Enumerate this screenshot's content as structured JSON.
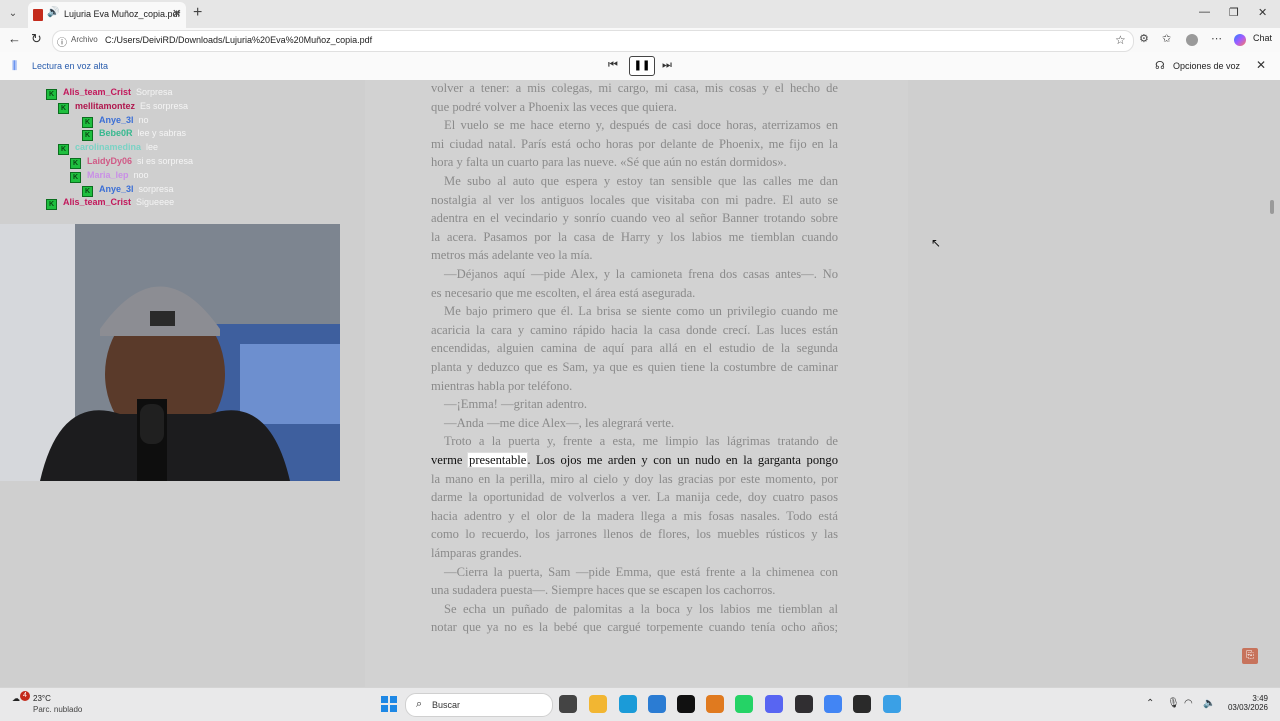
{
  "browser": {
    "tab_title": "Lujuria Eva Muñoz_copia.pdf",
    "address_prefix": "Archivo",
    "url": "C:/Users/DeiviRD/Downloads/Lujuria%20Eva%20Muñoz_copia.pdf",
    "chat_label": "Chat",
    "icons": [
      "tab-dropdown-icon",
      "pdf-icon",
      "speaker-icon",
      "close-icon",
      "plus-icon",
      "minimize-icon",
      "maximize-icon",
      "window-close-icon",
      "back-icon",
      "refresh-icon",
      "info-icon",
      "star-icon",
      "extensions-icon",
      "favorites-icon",
      "profile-icon",
      "more-icon",
      "copilot-icon"
    ]
  },
  "read_aloud": {
    "label": "Lectura en voz alta",
    "voice_options": "Opciones de voz"
  },
  "chat_overlay": [
    {
      "name": "Alis_team_Crist",
      "msg": "Sorpresa",
      "indent": 0,
      "color": "#c2185b"
    },
    {
      "name": "mellitamontez",
      "msg": "Es sorpresa",
      "indent": 1,
      "color": "#b0174e"
    },
    {
      "name": "Anye_3l",
      "msg": "no",
      "indent": 3,
      "color": "#3b6fd6"
    },
    {
      "name": "Bebe0R",
      "msg": "lee y sabras",
      "indent": 3,
      "color": "#37b98f"
    },
    {
      "name": "carolinamedina",
      "msg": "lee",
      "indent": 1,
      "color": "#7ad3c5"
    },
    {
      "name": "LaidyDy06",
      "msg": "si es sorpresa",
      "indent": 2,
      "color": "#d05a86"
    },
    {
      "name": "Maria_lep",
      "msg": "noo",
      "indent": 2,
      "color": "#c98fe6"
    },
    {
      "name": "Anye_3l",
      "msg": "sorpresa",
      "indent": 3,
      "color": "#3b6fd6"
    },
    {
      "name": "Alis_team_Crist",
      "msg": "Sigueeee",
      "indent": 0,
      "color": "#c2185b"
    }
  ],
  "pdf_lines": [
    {
      "text": "volver a tener: a mis colegas, mi cargo, mi casa, mis cosas y el hecho de",
      "j": true,
      "ind": false
    },
    {
      "text": "que podré volver a Phoenix las veces que quiera.",
      "j": false,
      "ind": false
    },
    {
      "text": "El vuelo se me hace eterno y, después de casi doce horas, aterrizamos en",
      "j": true,
      "ind": true
    },
    {
      "text": "mi ciudad natal. París está ocho horas por delante de Phoenix, me fijo en la",
      "j": true,
      "ind": false
    },
    {
      "text": "hora y falta un cuarto para las nueve. «Sé que aún no están dormidos».",
      "j": false,
      "ind": false
    },
    {
      "text": "Me subo al auto que espera y estoy tan sensible que las calles me dan",
      "j": true,
      "ind": true
    },
    {
      "text": "nostalgia al ver los antiguos locales que visitaba con mi padre. El auto se",
      "j": true,
      "ind": false
    },
    {
      "text": "adentra en el vecindario y sonrío cuando veo al señor Banner trotando sobre",
      "j": true,
      "ind": false
    },
    {
      "text": "la acera. Pasamos por la casa de Harry y los labios me tiemblan cuando",
      "j": true,
      "ind": false
    },
    {
      "text": "metros más adelante veo la mía.",
      "j": false,
      "ind": false
    },
    {
      "text": "—Déjanos aquí —pide Alex, y la camioneta frena dos casas antes—. No",
      "j": true,
      "ind": true
    },
    {
      "text": "es necesario que me escolten, el área está asegurada.",
      "j": false,
      "ind": false
    },
    {
      "text": "Me bajo primero que él. La brisa se siente como un privilegio cuando me",
      "j": true,
      "ind": true
    },
    {
      "text": "acaricia la cara y camino rápido hacia la casa donde crecí. Las luces están",
      "j": true,
      "ind": false
    },
    {
      "text": "encendidas, alguien camina de aquí para allá en el estudio de la segunda",
      "j": true,
      "ind": false
    },
    {
      "text": "planta y deduzco que es Sam, ya que es quien tiene la costumbre de caminar",
      "j": true,
      "ind": false
    },
    {
      "text": "mientras habla por teléfono.",
      "j": false,
      "ind": false
    },
    {
      "text": "—¡Emma! —gritan adentro.",
      "j": false,
      "ind": true
    },
    {
      "text": "—Anda —me dice Alex—, les alegrará verte.",
      "j": false,
      "ind": true
    },
    {
      "text": "Troto a la puerta y, frente a esta, me limpio las lágrimas tratando de",
      "j": true,
      "ind": true
    }
  ],
  "highlight_line": {
    "before": "verme ",
    "word": "presentable",
    "after": ". Los ojos me arden y con un nudo en la garganta pongo"
  },
  "pdf_lines_after": [
    {
      "text": "la mano en la perilla, miro al cielo y doy las gracias por este momento, por",
      "j": true,
      "ind": false
    },
    {
      "text": "darme la oportunidad de volverlos a ver. La manija cede, doy cuatro pasos",
      "j": true,
      "ind": false
    },
    {
      "text": "hacia adentro y el olor de la madera llega a mis fosas nasales. Todo está",
      "j": true,
      "ind": false
    },
    {
      "text": "como lo recuerdo, los jarrones llenos de flores, los muebles rústicos y las",
      "j": true,
      "ind": false
    },
    {
      "text": "lámparas grandes.",
      "j": false,
      "ind": false
    },
    {
      "text": "—Cierra la puerta, Sam —pide Emma, que está frente a la chimenea con",
      "j": true,
      "ind": true
    },
    {
      "text": "una sudadera puesta—. Siempre haces que se escapen los cachorros.",
      "j": false,
      "ind": false
    },
    {
      "text": "Se echa un puñado de palomitas a la boca y los labios me tiemblan al",
      "j": true,
      "ind": true
    },
    {
      "text": "notar que ya no es la bebé que cargué torpemente cuando tenía ocho años;",
      "j": true,
      "ind": false
    }
  ],
  "taskbar": {
    "weather_temp": "23°C",
    "weather_cond": "Parc. nublado",
    "weather_badge": "4",
    "search_label": "Buscar",
    "time": "3:49",
    "date": "03/03/2026",
    "apps": [
      {
        "name": "task-view-icon",
        "color": "#444444"
      },
      {
        "name": "file-explorer-icon",
        "color": "#f2b632"
      },
      {
        "name": "edge-icon",
        "color": "#1b9bd8"
      },
      {
        "name": "store-icon",
        "color": "#2b7cd3"
      },
      {
        "name": "capcut-icon",
        "color": "#111111"
      },
      {
        "name": "browser-orange-icon",
        "color": "#e07a1f"
      },
      {
        "name": "whatsapp-icon",
        "color": "#25d366"
      },
      {
        "name": "discord-icon",
        "color": "#5865f2"
      },
      {
        "name": "obs-icon",
        "color": "#302e31"
      },
      {
        "name": "chrome-icon",
        "color": "#4285f4"
      },
      {
        "name": "epic-games-icon",
        "color": "#2a2a2a"
      },
      {
        "name": "notepad-icon",
        "color": "#3aa0e6"
      }
    ]
  }
}
